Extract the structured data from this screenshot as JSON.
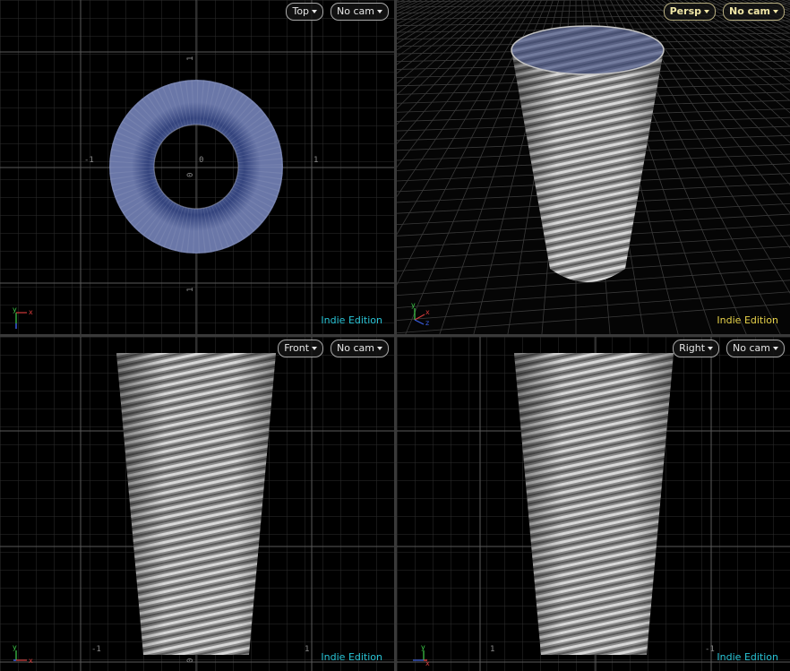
{
  "viewports": {
    "top": {
      "view_label": "Top",
      "camera_label": "No cam",
      "edition": "Indie Edition",
      "ticks": {
        "x_neg": "-1",
        "x_pos": "1",
        "origin_x": "0",
        "origin_y": "0",
        "y_top": "1",
        "y_bottom": "1"
      },
      "axes": {
        "vertical": "y",
        "horizontal": "x"
      }
    },
    "persp": {
      "view_label": "Persp",
      "camera_label": "No cam",
      "edition": "Indie Edition",
      "axes": {
        "vertical": "y",
        "horizontal": "x",
        "depth": "z"
      }
    },
    "front": {
      "view_label": "Front",
      "camera_label": "No cam",
      "edition": "Indie Edition",
      "ticks": {
        "x_neg": "-1",
        "x_pos": "1",
        "origin": "0"
      },
      "axes": {
        "vertical": "y",
        "horizontal": "x"
      }
    },
    "right": {
      "view_label": "Right",
      "camera_label": "No cam",
      "edition": "Indie Edition",
      "ticks": {
        "x_pos": "1",
        "x_neg": "-1"
      },
      "axes": {
        "vertical": "y",
        "horizontal": "x"
      }
    }
  },
  "colors": {
    "edition_cyan": "#29c4d6",
    "edition_yellow": "#e8d34a",
    "grid_minor": "#2f2f2f",
    "grid_major": "#5c5c5c",
    "mesh_light": "#c9c9c9",
    "mesh_dark": "#6e6e6e",
    "torus": "#2a3a78",
    "axis_x": "#d33a3a",
    "axis_y": "#3fce4b",
    "axis_z": "#3a5ee0"
  }
}
